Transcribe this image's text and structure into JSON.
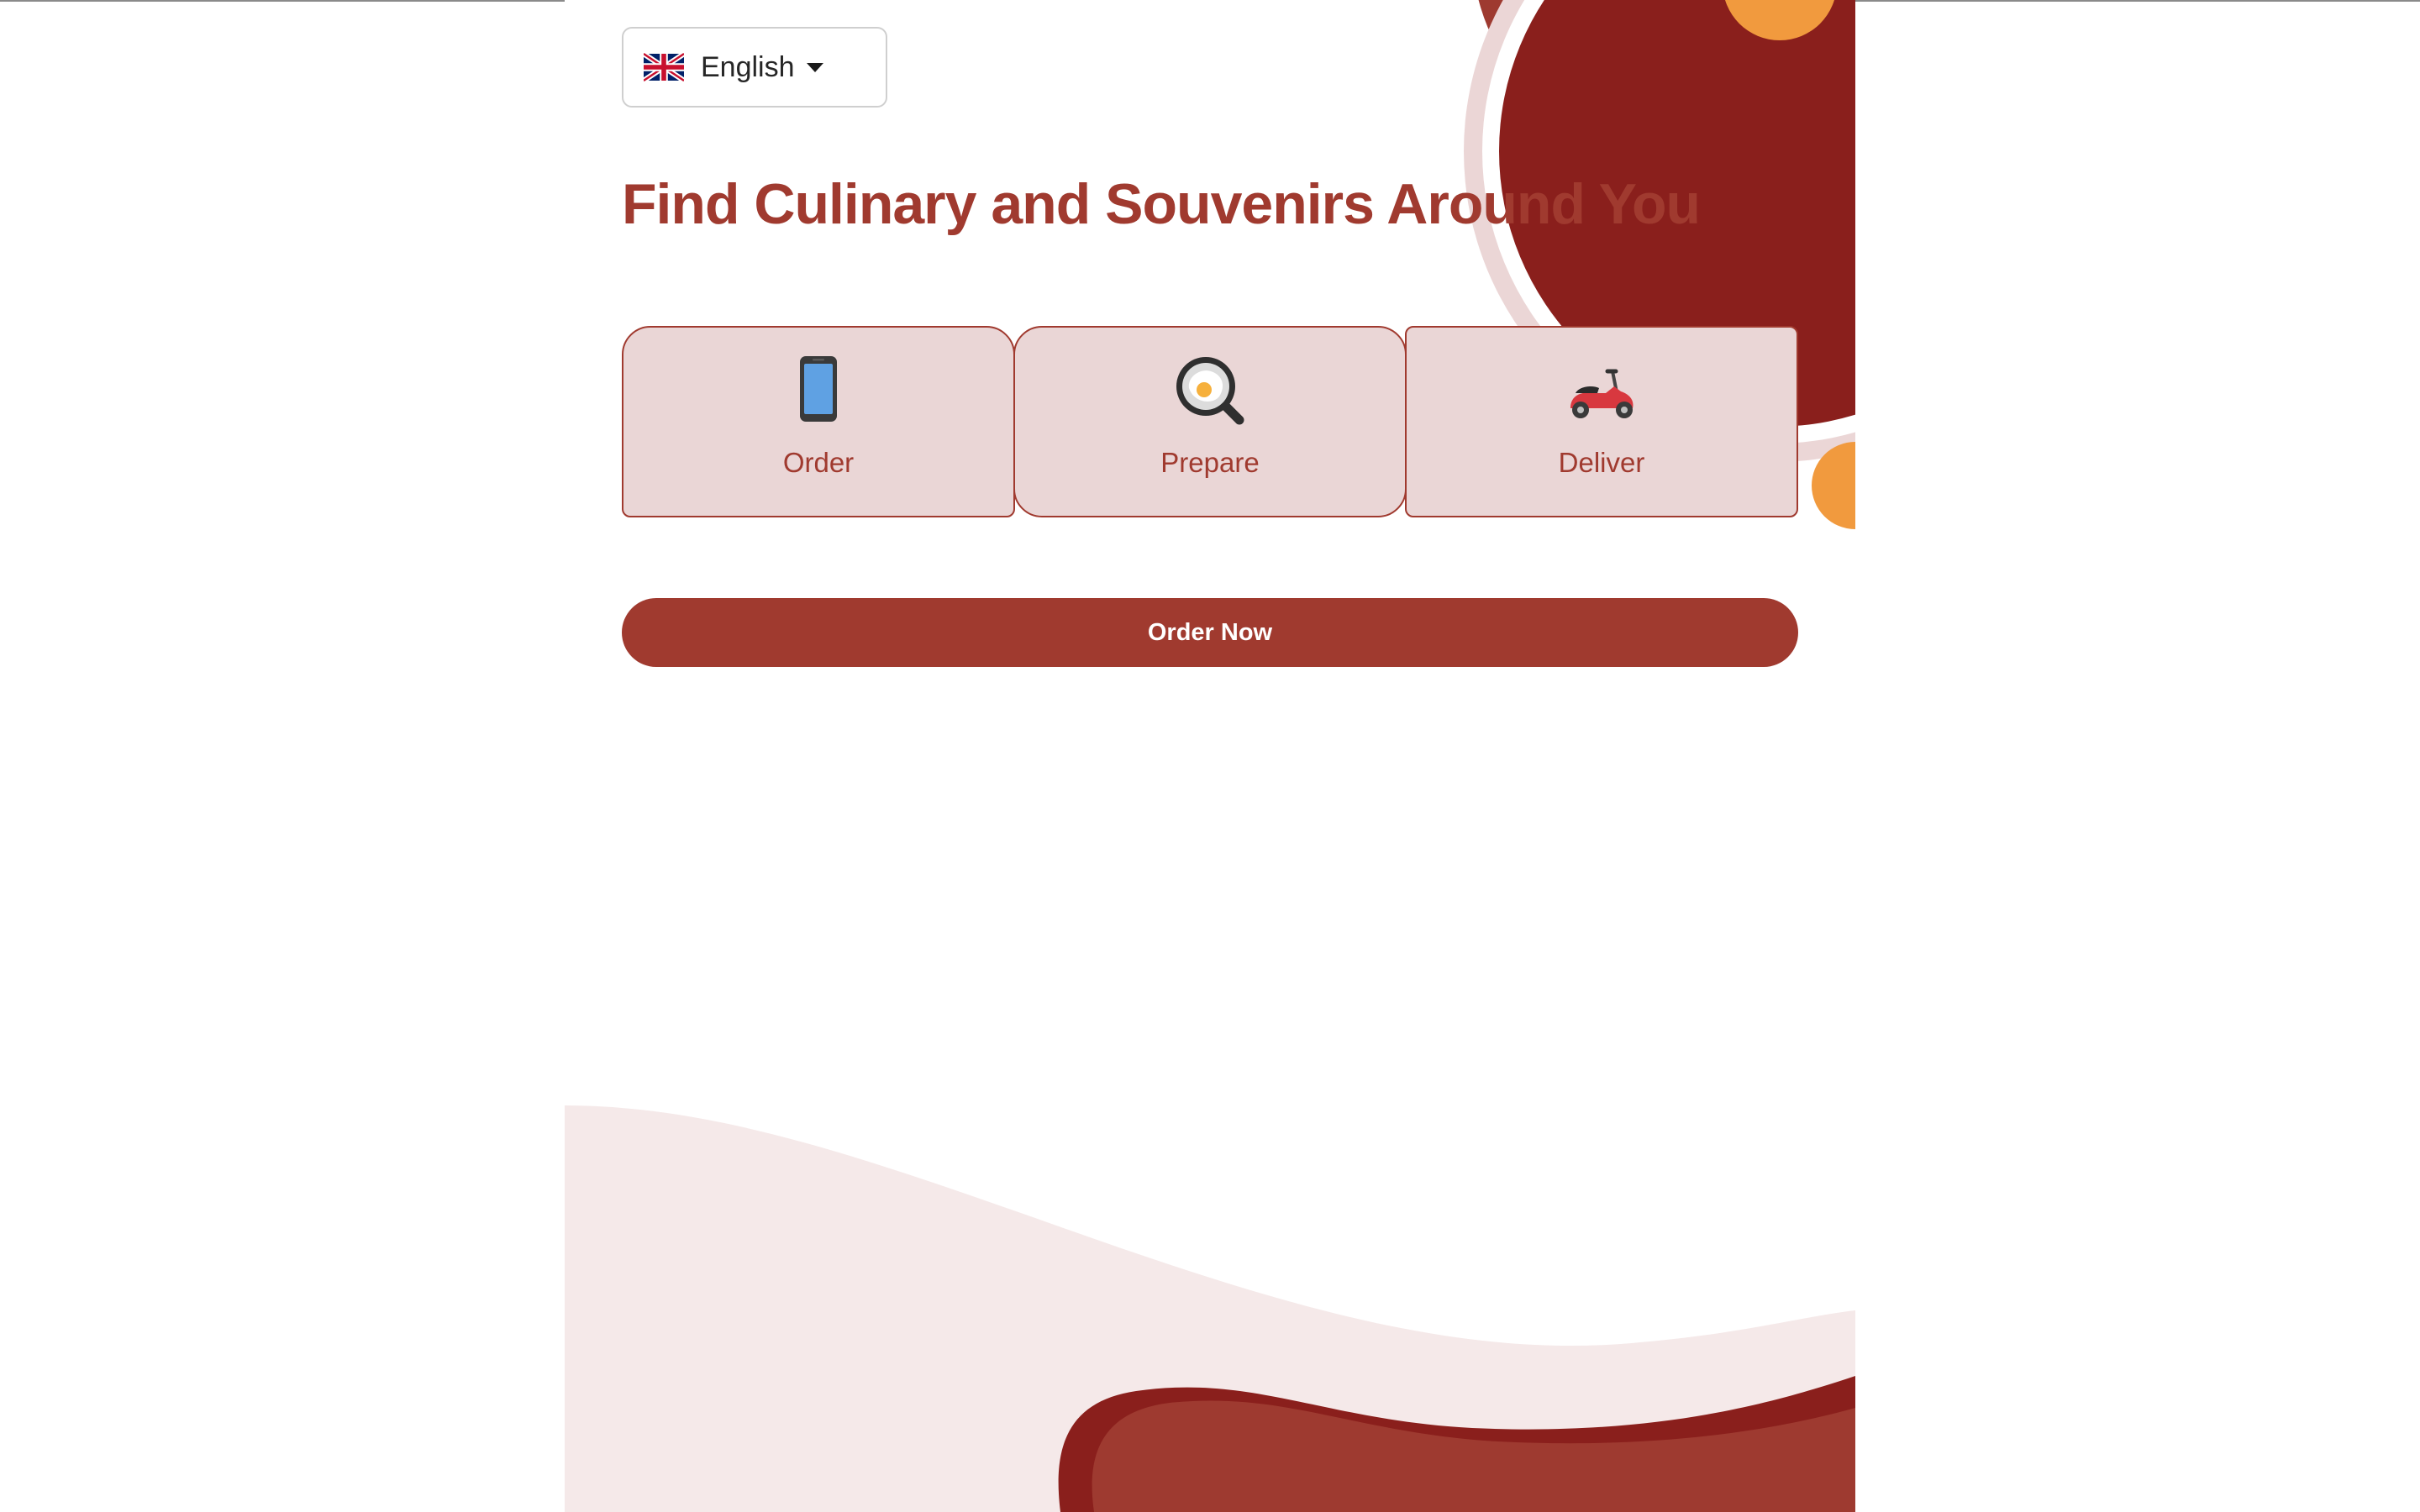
{
  "language": {
    "selected": "English",
    "flag_icon": "uk-flag-icon"
  },
  "hero": {
    "title": "Find Culinary and Souvenirs Around You"
  },
  "steps": [
    {
      "label": "Order",
      "icon": "mobile-phone-icon"
    },
    {
      "label": "Prepare",
      "icon": "frying-pan-egg-icon"
    },
    {
      "label": "Deliver",
      "icon": "scooter-icon"
    }
  ],
  "cta": {
    "label": "Order Now"
  },
  "colors": {
    "primary": "#a03a2f",
    "dark_red": "#8a1f1c",
    "card_bg": "#ead6d6",
    "orange": "#f19a3e",
    "wave_light": "#f5e9e9"
  }
}
